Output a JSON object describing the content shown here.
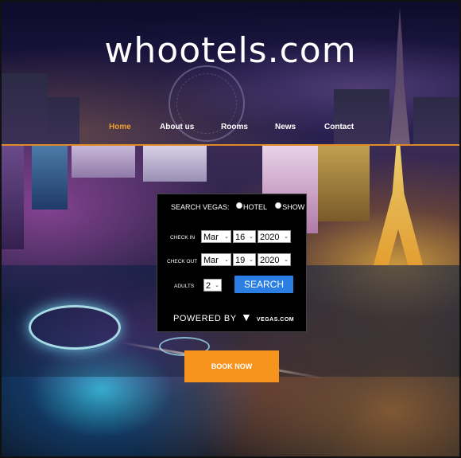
{
  "brand": {
    "logo_text": "whootels.com"
  },
  "nav": {
    "items": [
      {
        "label": "Home",
        "active": true
      },
      {
        "label": "About us",
        "active": false
      },
      {
        "label": "Rooms",
        "active": false
      },
      {
        "label": "News",
        "active": false
      },
      {
        "label": "Contact",
        "active": false
      }
    ]
  },
  "search": {
    "heading": "SEARCH VEGAS:",
    "options": [
      {
        "label": "HOTEL"
      },
      {
        "label": "SHOW"
      }
    ],
    "check_in": {
      "label": "CHECK IN",
      "month": "Mar",
      "day": "16",
      "year": "2020"
    },
    "check_out": {
      "label": "CHECK OUT",
      "month": "Mar",
      "day": "19",
      "year": "2020"
    },
    "adults": {
      "label": "ADULTS",
      "value": "2"
    },
    "button_label": "SEARCH",
    "powered_by": "POWERED BY",
    "partner": "VEGAS.COM"
  },
  "cta": {
    "label": "BOOK NOW"
  },
  "colors": {
    "accent": "#f7941d",
    "nav_active": "#f0a030",
    "search_button": "#2b7fe2",
    "divider": "#e08a25"
  }
}
